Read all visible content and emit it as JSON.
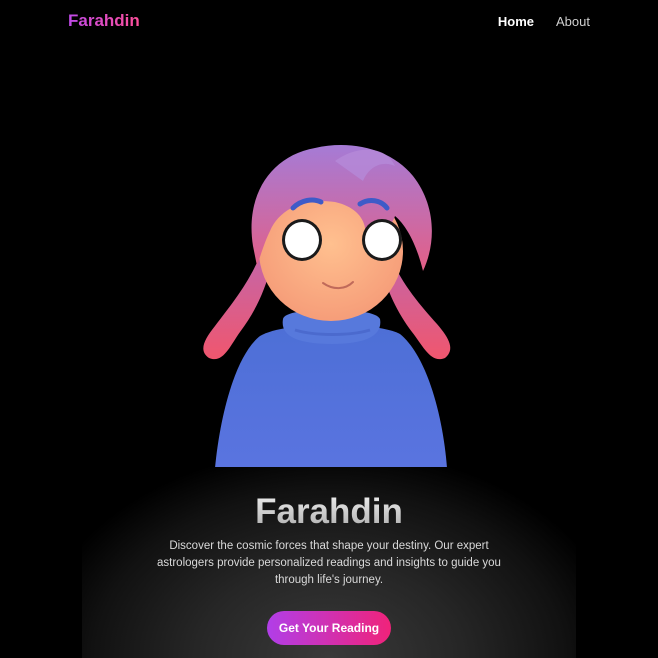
{
  "nav": {
    "brand": "Farahdin",
    "links": [
      {
        "label": "Home",
        "active": true
      },
      {
        "label": "About",
        "active": false
      }
    ]
  },
  "hero": {
    "image_icon": "cartoon-girl-illustration",
    "title": "Farahdin",
    "description": "Discover the cosmic forces that shape your destiny. Our expert astrologers provide personalized readings and insights to guide you through life's journey.",
    "cta_label": "Get Your Reading"
  },
  "colors": {
    "background": "#000000",
    "accent_start": "#b13ee8",
    "accent_end": "#f0237a"
  }
}
